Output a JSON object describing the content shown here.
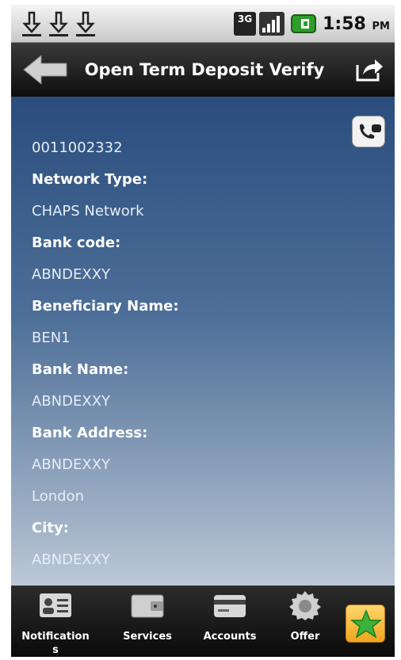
{
  "status_bar": {
    "network": "3G",
    "time": "1:58",
    "ampm": "PM"
  },
  "header": {
    "title": "Open Term Deposit Verify"
  },
  "details": [
    {
      "kind": "value",
      "text": "0011002332"
    },
    {
      "kind": "label",
      "text": "Network Type:"
    },
    {
      "kind": "value",
      "text": "CHAPS Network"
    },
    {
      "kind": "label",
      "text": "Bank code:"
    },
    {
      "kind": "value",
      "text": "ABNDEXXY"
    },
    {
      "kind": "label",
      "text": "Beneficiary Name:"
    },
    {
      "kind": "value",
      "text": "BEN1"
    },
    {
      "kind": "label",
      "text": "Bank Name:"
    },
    {
      "kind": "value",
      "text": "ABNDEXXY"
    },
    {
      "kind": "label",
      "text": "Bank Address:"
    },
    {
      "kind": "value",
      "text": "ABNDEXXY"
    },
    {
      "kind": "value",
      "text": "London"
    },
    {
      "kind": "label",
      "text": "City:"
    },
    {
      "kind": "value",
      "text": "ABNDEXXY"
    }
  ],
  "bottom_nav": {
    "items": [
      {
        "label": "Notification\ns",
        "icon": "contact-card-icon"
      },
      {
        "label": "Services",
        "icon": "wallet-icon"
      },
      {
        "label": "Accounts",
        "icon": "credit-card-icon"
      },
      {
        "label": "Offer",
        "icon": "gear-badge-icon"
      }
    ],
    "favorite_icon": "star-icon"
  },
  "colors": {
    "content_top": "#2a4d7e",
    "content_bottom": "#bcc8d6",
    "favorite": "#f0a51f",
    "star": "#3bb33b"
  }
}
